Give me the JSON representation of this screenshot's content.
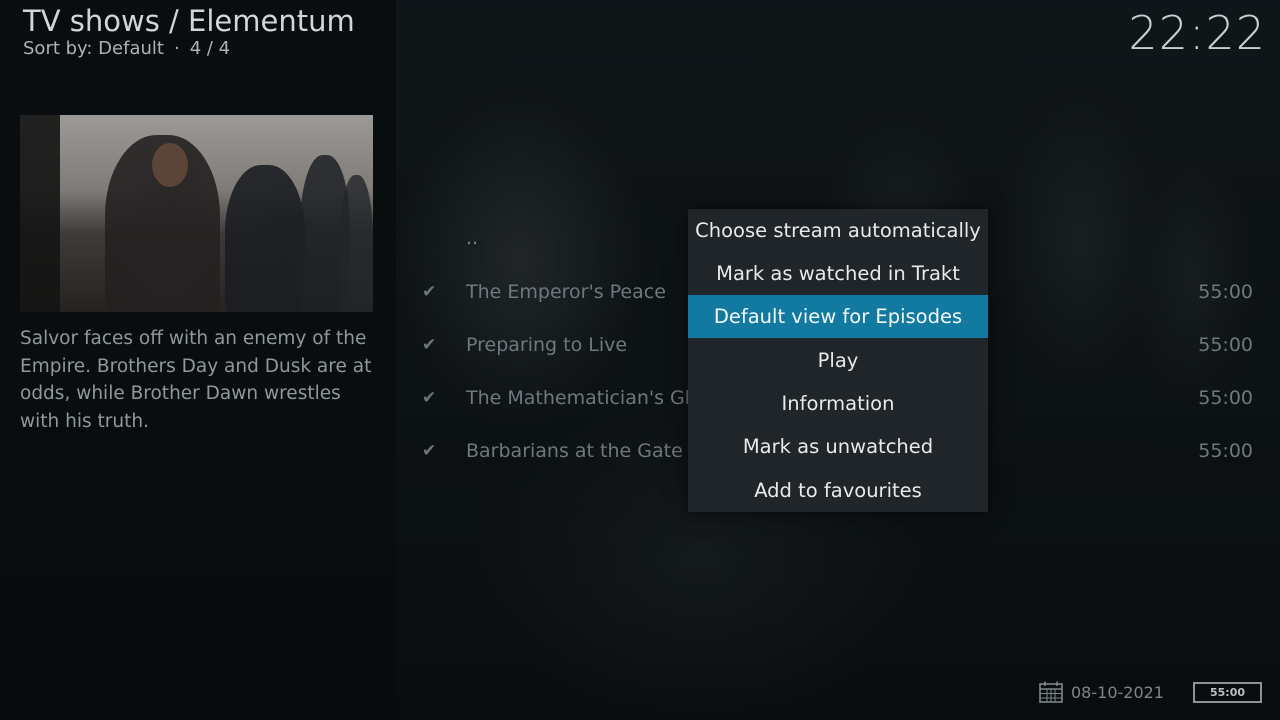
{
  "header": {
    "title": "TV shows / Elementum",
    "sort_label": "Sort by: Default",
    "separator": "·",
    "count": "4 / 4"
  },
  "clock": "22:22",
  "plot": "Salvor faces off with an enemy of the Empire. Brothers Day and Dusk are at odds, while Brother Dawn wrestles with his truth.",
  "list": {
    "parent": "..",
    "episodes": [
      {
        "title": "The Emperor's Peace",
        "duration": "55:00",
        "watched_icon": "check-icon"
      },
      {
        "title": "Preparing to Live",
        "duration": "55:00",
        "watched_icon": "check-icon"
      },
      {
        "title": "The Mathematician's Ghost",
        "duration": "55:00",
        "watched_icon": "check-icon"
      },
      {
        "title": "Barbarians at the Gate",
        "duration": "55:00",
        "watched_icon": "check-icon"
      }
    ]
  },
  "context_menu": {
    "items": [
      {
        "label": "Choose stream automatically"
      },
      {
        "label": "Mark as watched in Trakt"
      },
      {
        "label": "Default view for Episodes",
        "selected": true
      },
      {
        "label": "Play"
      },
      {
        "label": "Information"
      },
      {
        "label": "Mark as unwatched"
      },
      {
        "label": "Add to favourites"
      }
    ]
  },
  "footer": {
    "date_icon": "calendar-icon",
    "date": "08-10-2021",
    "duration_badge": "55:00"
  },
  "colors": {
    "accent": "#127aa1",
    "menu_bg": "#1f2529"
  }
}
